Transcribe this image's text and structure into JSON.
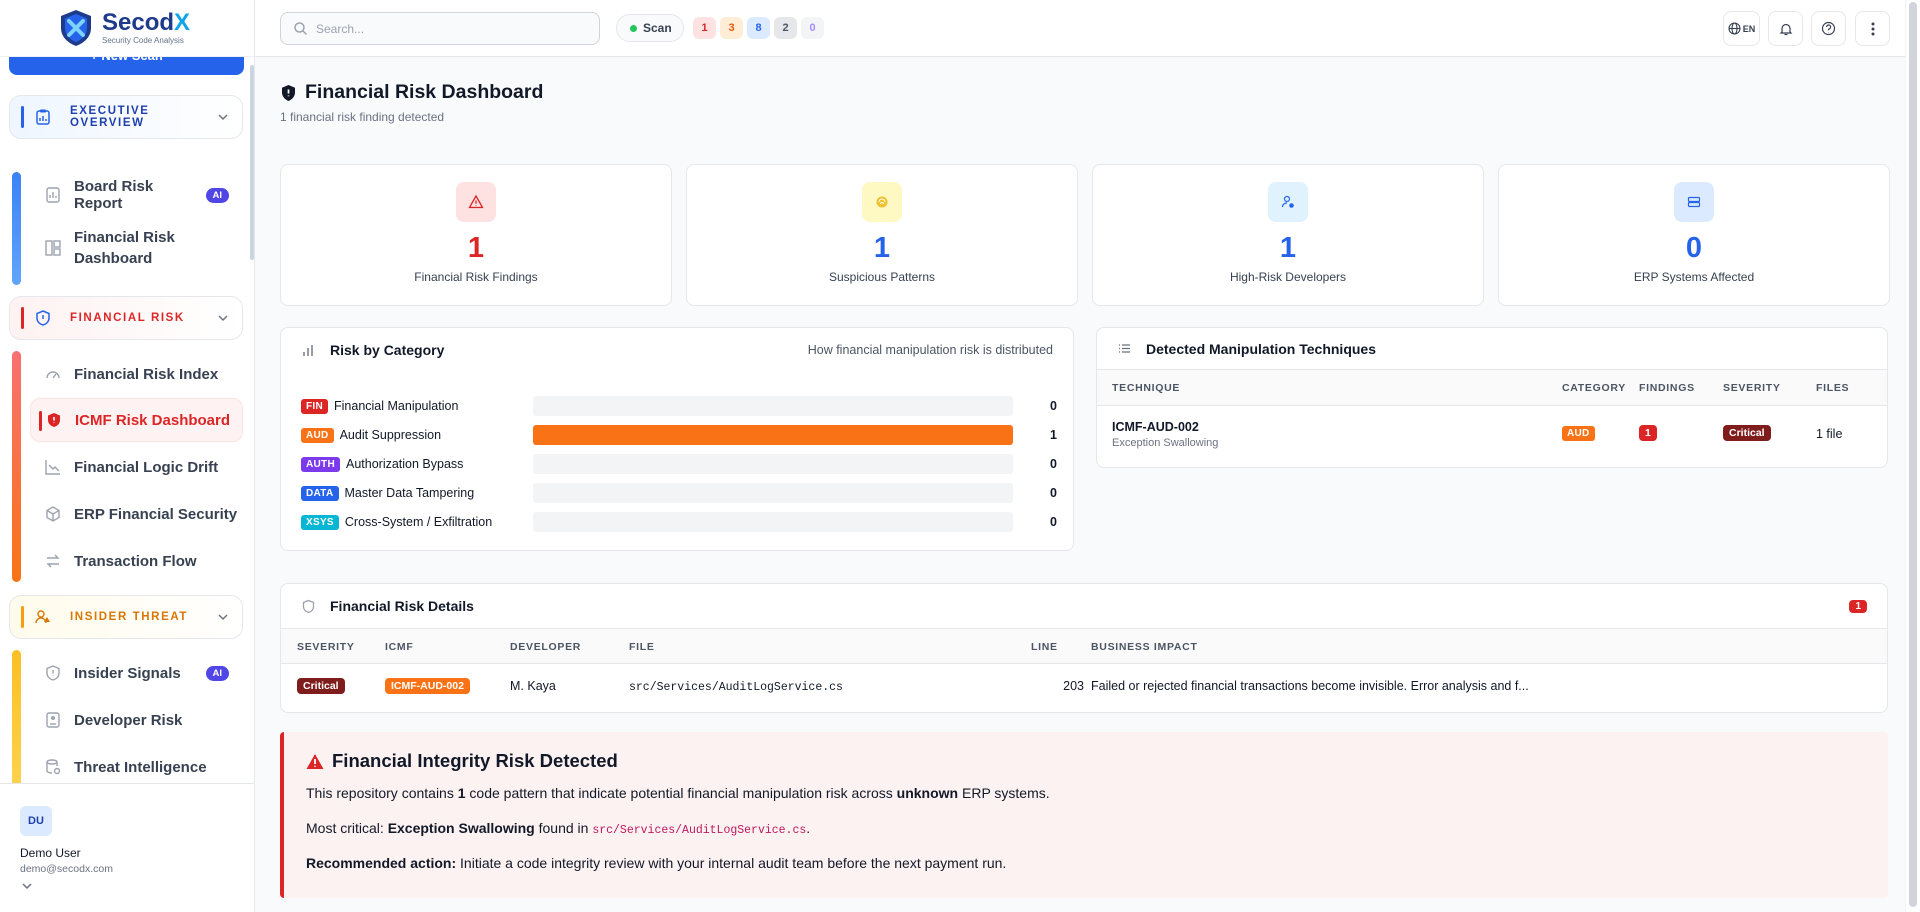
{
  "app": {
    "brand_a": "Secod",
    "brand_b": "X",
    "tagline": "Security Code Analysis"
  },
  "sidebar": {
    "new_scan": "+ New Scan",
    "groups": [
      {
        "label": "EXECUTIVE OVERVIEW",
        "color": "#2563eb"
      },
      {
        "label": "FINANCIAL RISK",
        "color": "#dc2626"
      },
      {
        "label": "INSIDER THREAT",
        "color": "#d97706"
      }
    ],
    "items": [
      {
        "label": "Board Risk Report",
        "badge": "AI"
      },
      {
        "label": "Financial Risk Dashboard"
      },
      {
        "label": "Financial Risk Index"
      },
      {
        "label": "ICMF Risk Dashboard"
      },
      {
        "label": "Financial Logic Drift"
      },
      {
        "label": "ERP Financial Security"
      },
      {
        "label": "Transaction Flow"
      },
      {
        "label": "Insider Signals",
        "badge": "AI"
      },
      {
        "label": "Developer Risk"
      },
      {
        "label": "Threat Intelligence"
      }
    ],
    "user": {
      "initials": "DU",
      "name": "Demo User",
      "email": "demo@secodx.com"
    }
  },
  "topbar": {
    "search_placeholder": "Search...",
    "scan_label": "Scan",
    "counts": [
      "1",
      "3",
      "8",
      "2",
      "0"
    ],
    "lang": "EN"
  },
  "page": {
    "title": "Financial Risk Dashboard",
    "subtitle": "1 financial risk finding detected"
  },
  "kpis": [
    {
      "value": "1",
      "label": "Financial Risk Findings",
      "color": "#dc2626"
    },
    {
      "value": "1",
      "label": "Suspicious Patterns",
      "color": "#2563eb"
    },
    {
      "value": "1",
      "label": "High-Risk Developers",
      "color": "#2563eb"
    },
    {
      "value": "0",
      "label": "ERP Systems Affected",
      "color": "#2563eb"
    }
  ],
  "risk_by_category": {
    "title": "Risk by Category",
    "subtitle": "How financial manipulation risk is distributed",
    "rows": [
      {
        "tag": "FIN",
        "name": "Financial Manipulation",
        "value": "0",
        "share": 0,
        "color": "#dc2626"
      },
      {
        "tag": "AUD",
        "name": "Audit Suppression",
        "value": "1",
        "share": 1,
        "color": "#f97316"
      },
      {
        "tag": "AUTH",
        "name": "Authorization Bypass",
        "value": "0",
        "share": 0,
        "color": "#7c3aed"
      },
      {
        "tag": "DATA",
        "name": "Master Data Tampering",
        "value": "0",
        "share": 0,
        "color": "#2563eb"
      },
      {
        "tag": "XSYS",
        "name": "Cross-System / Exfiltration",
        "value": "0",
        "share": 0,
        "color": "#06b6d4"
      }
    ]
  },
  "techniques": {
    "title": "Detected Manipulation Techniques",
    "headers": [
      "TECHNIQUE",
      "CATEGORY",
      "FINDINGS",
      "SEVERITY",
      "FILES"
    ],
    "row": {
      "id": "ICMF-AUD-002",
      "name": "Exception Swallowing",
      "category": "AUD",
      "findings": "1",
      "severity": "Critical",
      "files": "1 file"
    }
  },
  "details": {
    "title": "Financial Risk Details",
    "count": "1",
    "headers": [
      "SEVERITY",
      "ICMF",
      "DEVELOPER",
      "FILE",
      "LINE",
      "BUSINESS IMPACT"
    ],
    "row": {
      "severity": "Critical",
      "icmf": "ICMF-AUD-002",
      "developer": "M. Kaya",
      "file": "src/Services/AuditLogService.cs",
      "line": "203",
      "impact": "Failed or rejected financial transactions become invisible. Error analysis and f..."
    }
  },
  "alert": {
    "title": "Financial Integrity Risk Detected",
    "l1a": "This repository contains ",
    "l1b": "1",
    "l1c": " code pattern that indicate potential financial manipulation risk across ",
    "l1d": "unknown",
    "l1e": " ERP systems.",
    "l2a": "Most critical: ",
    "l2b": "Exception Swallowing",
    "l2c": " found in ",
    "l2d": "src/Services/AuditLogService.cs",
    "l2e": ".",
    "l3a": "Recommended action:",
    "l3b": " Initiate a code integrity review with your internal audit team before the next payment run."
  }
}
